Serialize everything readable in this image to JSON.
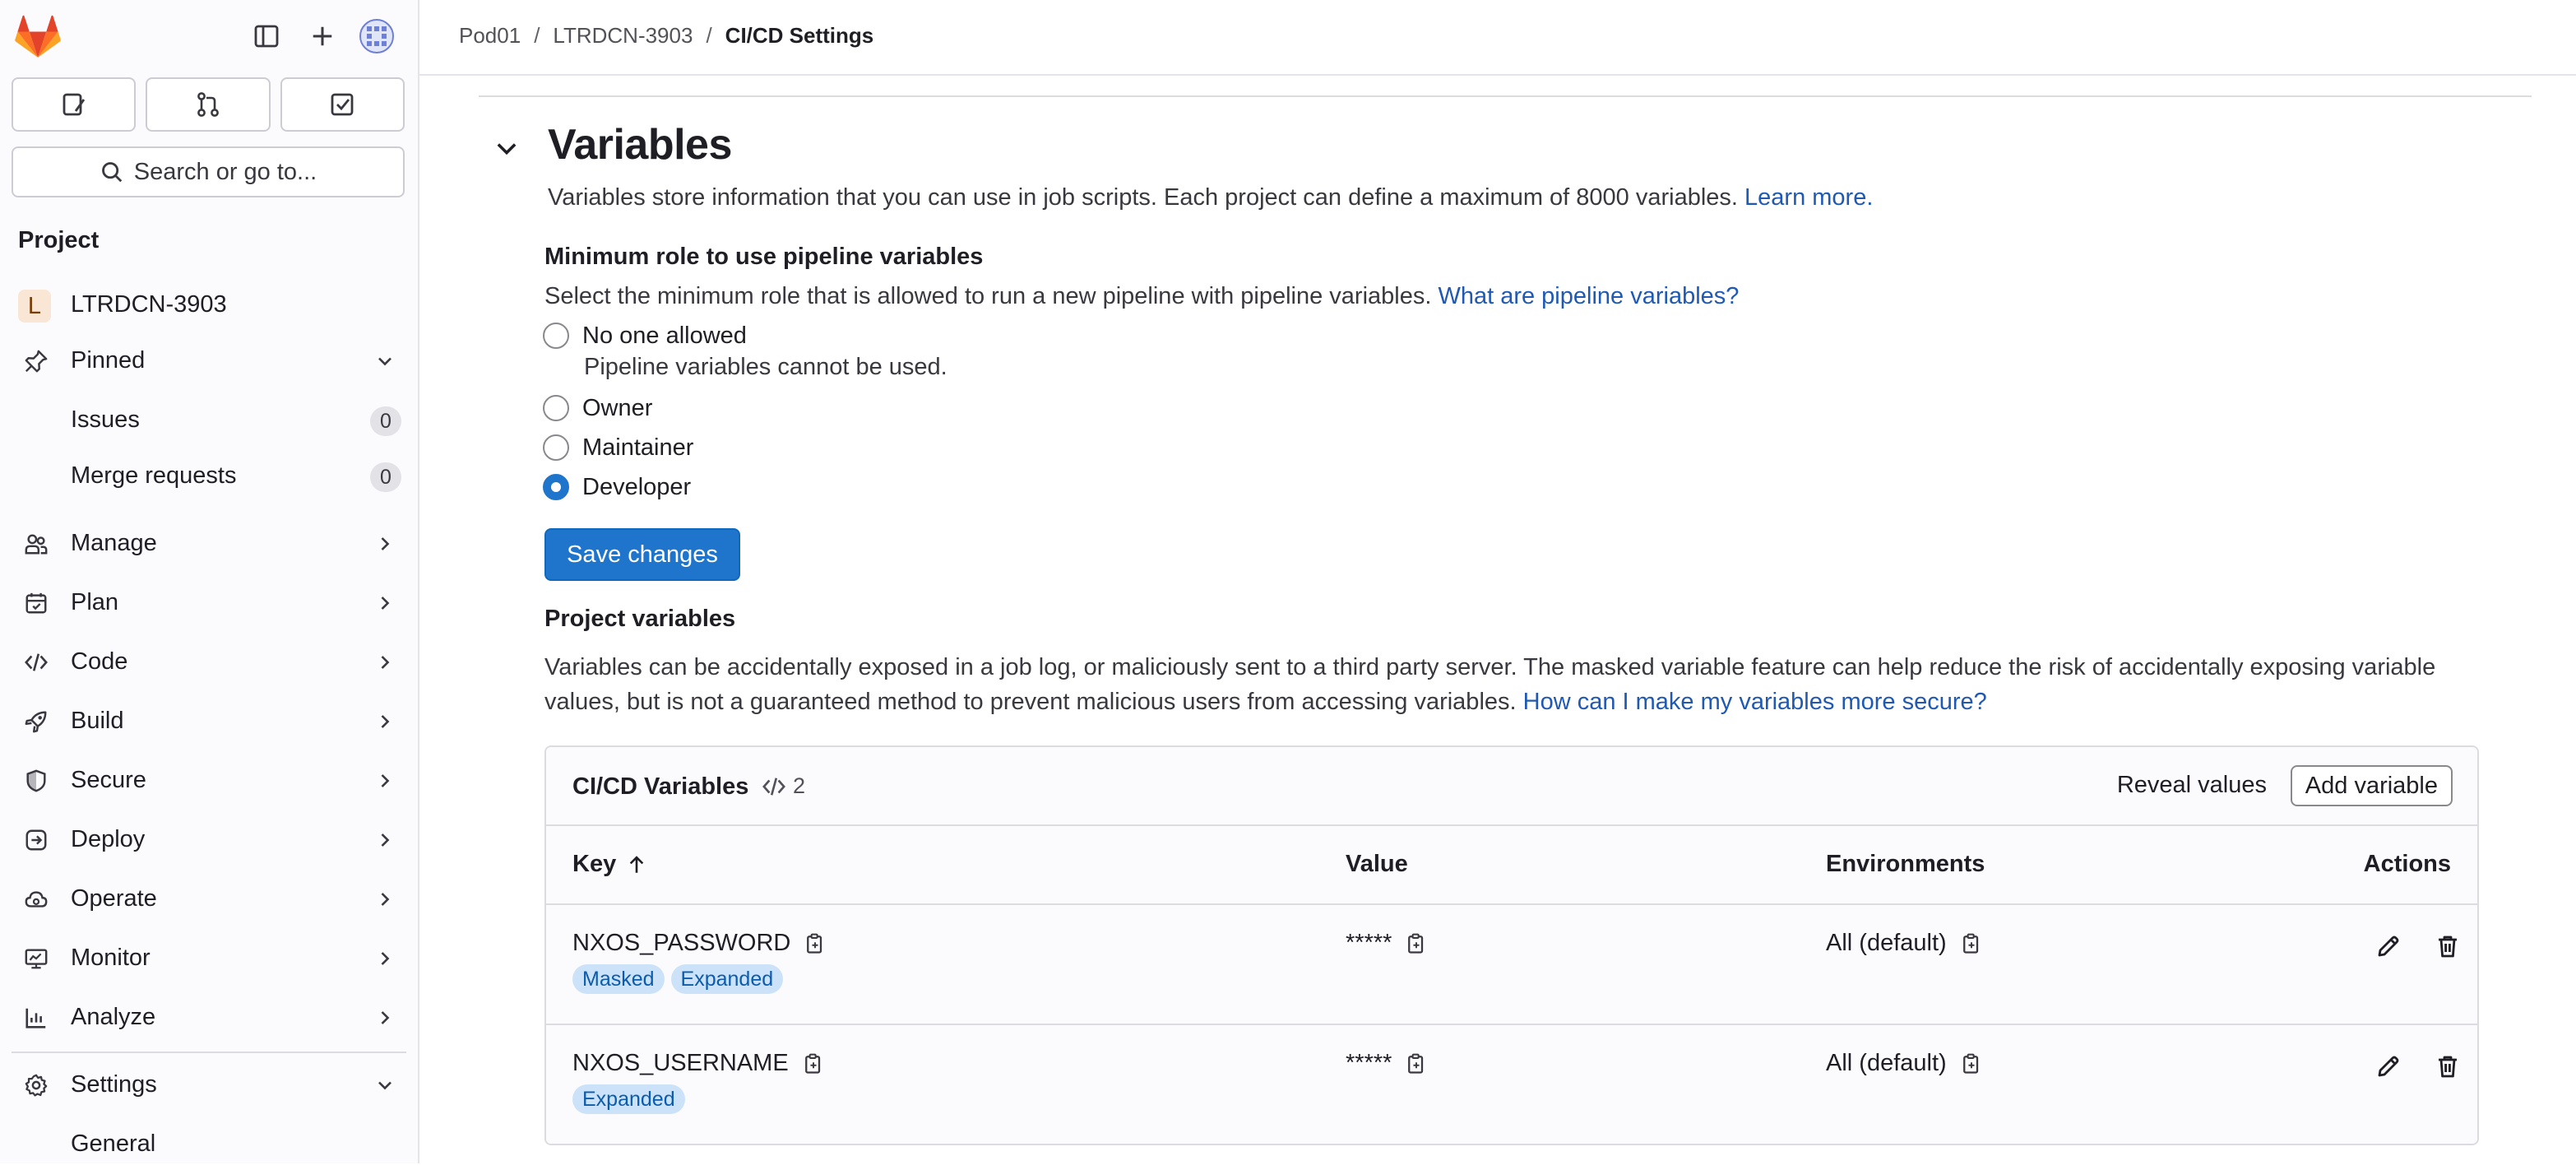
{
  "sidebar": {
    "search_placeholder": "Search or go to...",
    "section_title": "Project",
    "project": {
      "avatar_letter": "L",
      "name": "LTRDCN-3903"
    },
    "pinned": {
      "label": "Pinned",
      "items": [
        {
          "label": "Issues",
          "count": "0"
        },
        {
          "label": "Merge requests",
          "count": "0"
        }
      ]
    },
    "nav": [
      {
        "label": "Manage",
        "icon": "users-icon"
      },
      {
        "label": "Plan",
        "icon": "calendar-icon"
      },
      {
        "label": "Code",
        "icon": "code-icon"
      },
      {
        "label": "Build",
        "icon": "rocket-icon"
      },
      {
        "label": "Secure",
        "icon": "shield-icon"
      },
      {
        "label": "Deploy",
        "icon": "deploy-icon"
      },
      {
        "label": "Operate",
        "icon": "cloud-gear-icon"
      },
      {
        "label": "Monitor",
        "icon": "monitor-icon"
      },
      {
        "label": "Analyze",
        "icon": "chart-icon"
      }
    ],
    "settings": {
      "label": "Settings",
      "sub": "General"
    }
  },
  "breadcrumb": {
    "items": [
      "Pod01",
      "LTRDCN-3903",
      "CI/CD Settings"
    ]
  },
  "variables": {
    "title": "Variables",
    "description": "Variables store information that you can use in job scripts. Each project can define a maximum of 8000 variables.",
    "learn_more": "Learn more.",
    "min_role": {
      "label": "Minimum role to use pipeline variables",
      "description": "Select the minimum role that is allowed to run a new pipeline with pipeline variables.",
      "help_link": "What are pipeline variables?",
      "options": [
        {
          "label": "No one allowed",
          "help": "Pipeline variables cannot be used.",
          "checked": false
        },
        {
          "label": "Owner",
          "checked": false
        },
        {
          "label": "Maintainer",
          "checked": false
        },
        {
          "label": "Developer",
          "checked": true
        }
      ],
      "save_label": "Save changes"
    },
    "project_vars": {
      "label": "Project variables",
      "description": "Variables can be accidentally exposed in a job log, or maliciously sent to a third party server. The masked variable feature can help reduce the risk of accidentally exposing variable values, but is not a guaranteed method to prevent malicious users from accessing variables.",
      "help_link": "How can I make my variables more secure?"
    },
    "table": {
      "title": "CI/CD Variables",
      "count": "2",
      "reveal_label": "Reveal values",
      "add_label": "Add variable",
      "columns": {
        "key": "Key",
        "value": "Value",
        "environments": "Environments",
        "actions": "Actions"
      },
      "rows": [
        {
          "key": "NXOS_PASSWORD",
          "value": "*****",
          "env": "All (default)",
          "badges": [
            "Masked",
            "Expanded"
          ]
        },
        {
          "key": "NXOS_USERNAME",
          "value": "*****",
          "env": "All (default)",
          "badges": [
            "Expanded"
          ]
        }
      ]
    }
  }
}
